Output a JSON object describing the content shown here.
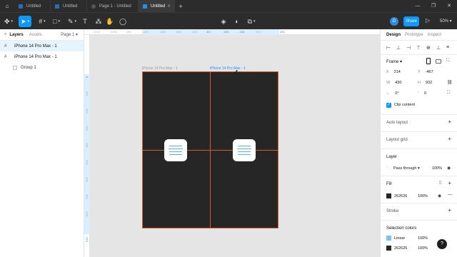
{
  "tabs": [
    {
      "label": "Untitled",
      "active": false
    },
    {
      "label": "Untitled",
      "active": false
    },
    {
      "label": "Page 1 - Untitled",
      "active": false
    },
    {
      "label": "Untitled",
      "active": true
    }
  ],
  "toolbar": {
    "avatar_initial": "D",
    "share_label": "Share",
    "zoom_label": "50%"
  },
  "left_panel": {
    "tab_layers": "Layers",
    "tab_assets": "Assets",
    "page_selector": "Page 1",
    "layers": [
      {
        "label": "iPhone 14 Pro Max - 1",
        "selected": true
      },
      {
        "label": "iPhone 14 Pro Max - 1",
        "selected": false
      },
      {
        "label": "Group 1",
        "selected": false
      }
    ]
  },
  "canvas": {
    "frame_label_a": "iPhone 14 Pro Max - 1",
    "frame_label_b": "iPhone 14 Pro Max - 1",
    "ruler_top": [
      "-1100",
      "-1000",
      "-900",
      "-800",
      "-600",
      "-500",
      "-400",
      "-300",
      "-200",
      "-100",
      "0",
      "100",
      "200",
      "300",
      "430"
    ],
    "ruler_top_selected": [
      "0",
      "430"
    ],
    "ruler_left": [
      "0",
      "100",
      "200",
      "300",
      "400",
      "500",
      "600",
      "700",
      "800",
      "932"
    ],
    "frame_fill": "#262626",
    "selection_color": "#d85a2a"
  },
  "right_panel": {
    "tab_design": "Design",
    "tab_prototype": "Prototype",
    "tab_inspect": "Inspect",
    "frame": {
      "title": "Frame",
      "x_label": "X",
      "x_value": "214",
      "y_label": "Y",
      "y_value": "-467",
      "w_label": "W",
      "w_value": "430",
      "h_label": "H",
      "h_value": "932",
      "rotation_value": "0°",
      "radius_value": "0",
      "clip_content_label": "Clip content"
    },
    "auto_layout": "Auto layout",
    "layout_grid": "Layout grid",
    "layer": {
      "title": "Layer",
      "blend_mode": "Pass through",
      "opacity": "100%"
    },
    "fill": {
      "title": "Fill",
      "hex": "262626",
      "opacity": "100%",
      "color": "#262626"
    },
    "stroke": "Stroke",
    "selection_colors": {
      "title": "Selection colors",
      "items": [
        {
          "label": "Linear",
          "opacity": "100%",
          "color": "#7cc4f0"
        },
        {
          "label": "262626",
          "opacity": "100%",
          "color": "#262626"
        }
      ]
    }
  },
  "help_label": "?"
}
